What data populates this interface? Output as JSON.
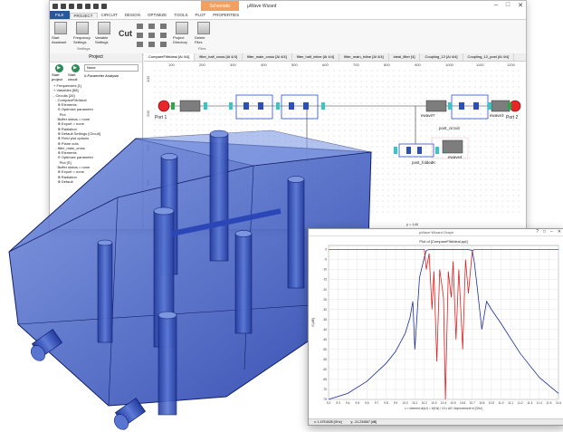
{
  "app": {
    "title": "µWave Wizard",
    "context_tab": "Schematic",
    "window_controls": [
      "–",
      "□",
      "✕"
    ]
  },
  "menu": [
    "FILE",
    "PROJECT",
    "CIRCUIT",
    "DESIGN",
    "OPTIMIZE",
    "TOOLS",
    "PLOT",
    "PROPERTIES"
  ],
  "ribbon": {
    "buttons": [
      {
        "label": "Start Assistant",
        "icon": "assistant-icon"
      },
      {
        "label": "Frequency Settings",
        "icon": "frequency-icon"
      },
      {
        "label": "Variable Settings",
        "icon": "variable-icon"
      }
    ],
    "cut_label": "Cut",
    "right_buttons": [
      {
        "label": "Project Directory",
        "icon": "folder-icon"
      },
      {
        "label": "Delete Files",
        "icon": "delete-icon"
      }
    ],
    "group_settings": "Settings",
    "group_files": "Files"
  },
  "project_panel": {
    "title": "Project",
    "start_project": "Start project",
    "start_circuit": "Start circuit",
    "dropdown_value": "None",
    "analysis_label": "0-Parameter Analysis",
    "tree": [
      "+ Frequencies [1]",
      "+ Variables [68]",
      "- Circuits [26]",
      "  - CompareFiltrIdeal",
      "    ⊕ Elements",
      "    ⊖ Optimize parameter",
      "      Plot",
      "    Buffer status = none",
      "    ⊕ Export = none",
      "    ⊕ Radiation",
      "    ⊕ Default Settings [Circuit]",
      "    ⊕ Field plot options",
      "    ⊕ Plane cuts",
      "  - filter_main_cross",
      "    ⊕ Elements",
      "    ⊖ Optimize parameter",
      "      Plot [S]",
      "    Buffer status = none",
      "    ⊕ Export = none",
      "    ⊕ Radiation",
      "    ⊕ Default"
    ]
  },
  "canvas": {
    "tabs": [
      "CompareFiltrIdeal [Ai 4/4]",
      "filter_half_cross [Ai 4/4]",
      "filter_main_cross [Ai 4/4]",
      "filter_half_inline [Ai 4/4]",
      "filter_main_inline [Ai 4/4]",
      "ideal_filter [4]",
      "Coupling_12 [Ai 4/4]",
      "Coupling_12_post [Ai 4/4]"
    ],
    "ruler_x": [
      "100",
      "200",
      "300",
      "400",
      "500",
      "600",
      "700",
      "800",
      "900",
      "1000",
      "1100",
      "1200"
    ],
    "ruler_y": [
      "100",
      "200",
      "300",
      "400"
    ],
    "port_left": "Port 1",
    "port_right": "Port 2",
    "labels": [
      "ewave7",
      "ewave3",
      "post_circuit",
      "post_foldedK",
      "ewave4"
    ],
    "coord_readout": "y = 140"
  },
  "plot_window": {
    "title": "µWave Wizard Graph",
    "plot_title": "Plot of [CompareFiltrIdeal.ppt]",
    "x_axis_label": "x = element of(a,f) = 1f(Hz) / 10 x ΔS / Improvement in [GHz]",
    "y_axis_label": "S [dB]",
    "status_left": "x: 1.47E4028 [GHz]",
    "status_right": "y: -21.234567 [dB]",
    "controls": [
      "?",
      "□",
      "–",
      "✕"
    ]
  },
  "chart_data": {
    "type": "line",
    "title": "Plot of [CompareFiltrIdeal.ppt]",
    "xlabel": "x = element of(a,f) = 1f(Hz) / 10 x ΔS / Improvement in [GHz]",
    "ylabel": "S [dB]",
    "xlim": [
      9.2,
      11.6
    ],
    "ylim": [
      -75,
      2
    ],
    "x_ticks": [
      "9.2",
      "9.3",
      "9.4",
      "9.5",
      "9.6",
      "9.7",
      "9.8",
      "9.9",
      "10.0",
      "10.1",
      "10.2",
      "10.3",
      "10.4",
      "10.5",
      "10.6",
      "10.7",
      "10.8",
      "10.9",
      "11.0",
      "11.1",
      "11.2",
      "11.3",
      "11.4",
      "11.5",
      "11.6"
    ],
    "y_ticks": [
      "0",
      "-5",
      "-10",
      "-15",
      "-20",
      "-25",
      "-30",
      "-35",
      "-40",
      "-45",
      "-50",
      "-55",
      "-60",
      "-65",
      "-70",
      "-75"
    ],
    "grid": true,
    "series": [
      {
        "color": "#1a2fa0",
        "x": [
          9.2,
          9.4,
          9.6,
          9.8,
          9.9,
          10.0,
          10.05,
          10.08,
          10.1,
          10.15,
          10.2,
          10.22,
          10.25,
          10.3,
          10.4,
          10.5,
          10.6,
          10.65,
          10.7,
          10.72,
          10.75,
          10.8,
          10.85,
          10.9,
          11.0,
          11.2,
          11.4,
          11.6
        ],
        "y": [
          -75,
          -72,
          -66,
          -57,
          -51,
          -42,
          -34,
          -26,
          -50,
          -14,
          -4,
          -0.5,
          0,
          0,
          0,
          0,
          0,
          0,
          -0.5,
          -6,
          -18,
          -40,
          -26,
          -30,
          -37,
          -52,
          -64,
          -72
        ]
      },
      {
        "color": "#e02020",
        "x": [
          10.2,
          10.22,
          10.25,
          10.28,
          10.3,
          10.33,
          10.36,
          10.4,
          10.42,
          10.45,
          10.48,
          10.5,
          10.53,
          10.56,
          10.6,
          10.63,
          10.66,
          10.7,
          10.72
        ],
        "y": [
          0,
          -10,
          -2,
          -30,
          -11,
          -56,
          -10,
          -24,
          -75,
          -11,
          -24,
          -6,
          -45,
          -10,
          -50,
          -5,
          -22,
          -1,
          0
        ]
      },
      {
        "color": "#e02020",
        "x": [
          9.2,
          10.2
        ],
        "y": [
          0,
          0
        ]
      },
      {
        "color": "#e02020",
        "x": [
          10.72,
          11.6
        ],
        "y": [
          0,
          0
        ]
      }
    ]
  },
  "colors": {
    "file_menu": "#2b5797",
    "context_tab": "#f0a060",
    "model_blue": "#2b4ec8",
    "port": "#e8262a",
    "series_blue": "#1a2fa0",
    "series_red": "#e02020"
  }
}
